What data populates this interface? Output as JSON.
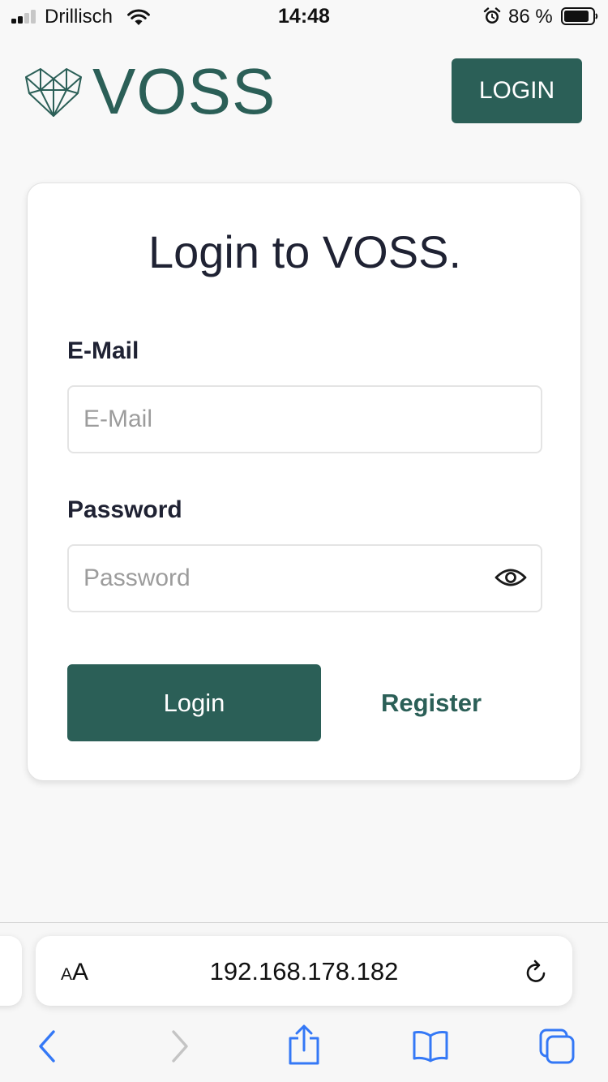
{
  "status_bar": {
    "carrier": "Drillisch",
    "time": "14:48",
    "battery_percent": "86 %",
    "icons": [
      "signal-icon",
      "wifi-icon",
      "alarm-icon",
      "battery-icon"
    ]
  },
  "header": {
    "logo_text": "VOSS",
    "login_button": "LOGIN"
  },
  "login_card": {
    "title": "Login to VOSS.",
    "email": {
      "label": "E-Mail",
      "placeholder": "E-Mail",
      "value": ""
    },
    "password": {
      "label": "Password",
      "placeholder": "Password",
      "value": ""
    },
    "submit_label": "Login",
    "register_label": "Register"
  },
  "browser": {
    "aa_small": "A",
    "aa_large": "A",
    "url": "192.168.178.182",
    "toolbar_icons": [
      "back-icon",
      "forward-icon",
      "share-icon",
      "bookmarks-icon",
      "tabs-icon"
    ]
  },
  "colors": {
    "brand": "#2b5f57",
    "text": "#1f2233",
    "placeholder": "#9c9c9c",
    "ios_blue": "#3478f6"
  }
}
